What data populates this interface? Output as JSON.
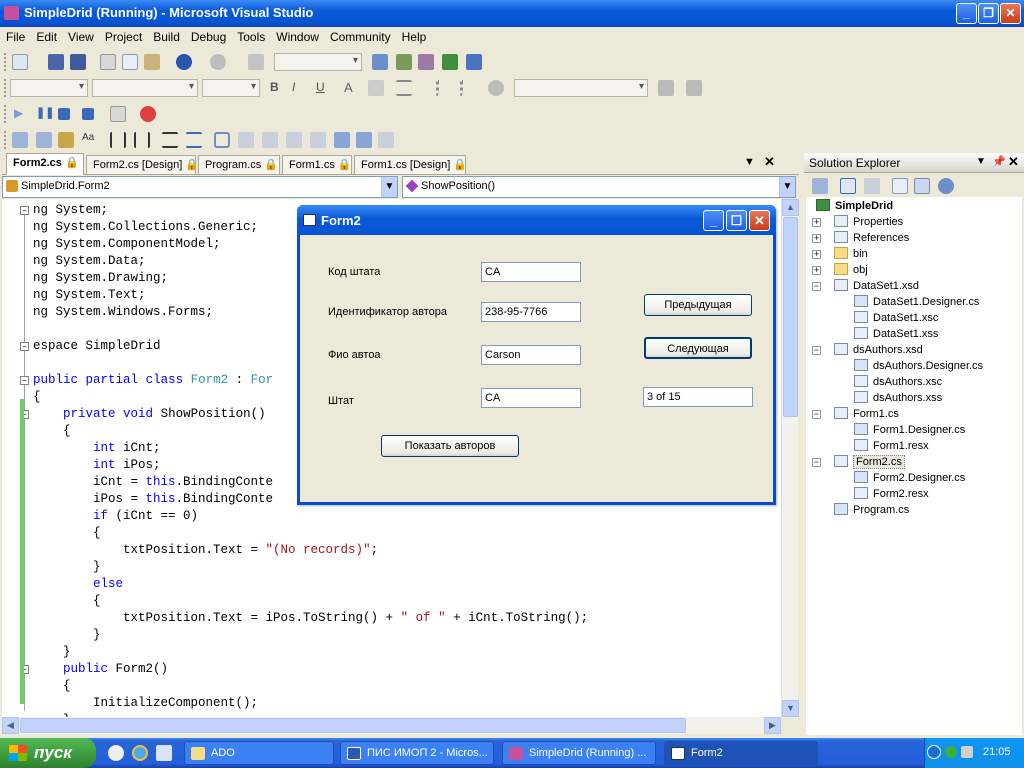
{
  "window": {
    "title": "SimpleDrid (Running) - Microsoft Visual Studio"
  },
  "menu": [
    "File",
    "Edit",
    "View",
    "Project",
    "Build",
    "Debug",
    "Tools",
    "Window",
    "Community",
    "Help"
  ],
  "tabs": [
    {
      "label": "Form2.cs",
      "active": true
    },
    {
      "label": "Form2.cs [Design]",
      "active": false
    },
    {
      "label": "Program.cs",
      "active": false
    },
    {
      "label": "Form1.cs",
      "active": false
    },
    {
      "label": "Form1.cs [Design]",
      "active": false
    }
  ],
  "nav": {
    "class_combo": "SimpleDrid.Form2",
    "member_combo": "ShowPosition()"
  },
  "code_lines": [
    [
      "",
      "ng System;"
    ],
    [
      "",
      "ng System.Collections.Generic;"
    ],
    [
      "",
      "ng System.ComponentModel;"
    ],
    [
      "",
      "ng System.Data;"
    ],
    [
      "",
      "ng System.Drawing;"
    ],
    [
      "",
      "ng System.Text;"
    ],
    [
      "",
      "ng System.Windows.Forms;"
    ],
    [
      "",
      ""
    ],
    [
      "",
      "espace SimpleDrid"
    ],
    [
      "",
      ""
    ],
    [
      "",
      "public partial class Form2 : For"
    ],
    [
      "",
      "{"
    ],
    [
      "",
      "    private void ShowPosition()"
    ],
    [
      "",
      "    {"
    ],
    [
      "",
      "        int iCnt;"
    ],
    [
      "",
      "        int iPos;"
    ],
    [
      "",
      "        iCnt = this.BindingConte"
    ],
    [
      "",
      "        iPos = this.BindingConte"
    ],
    [
      "",
      "        if (iCnt == 0)"
    ],
    [
      "",
      "        {"
    ],
    [
      "",
      "            txtPosition.Text = \"(No records)\";"
    ],
    [
      "",
      "        }"
    ],
    [
      "",
      "        else"
    ],
    [
      "",
      "        {"
    ],
    [
      "",
      "            txtPosition.Text = iPos.ToString() + \" of \" + iCnt.ToString();"
    ],
    [
      "",
      "        }"
    ],
    [
      "",
      "    }"
    ],
    [
      "",
      "    public Form2()"
    ],
    [
      "",
      "    {"
    ],
    [
      "",
      "        InitializeComponent();"
    ],
    [
      "",
      "    }"
    ]
  ],
  "solution_explorer": {
    "title": "Solution Explorer",
    "project": "SimpleDrid",
    "items": [
      {
        "label": "Properties",
        "level": 1,
        "expand": "+",
        "icon": "properties-icon"
      },
      {
        "label": "References",
        "level": 1,
        "expand": "+",
        "icon": "references-icon"
      },
      {
        "label": "bin",
        "level": 1,
        "expand": "+",
        "icon": "folder-icon"
      },
      {
        "label": "obj",
        "level": 1,
        "expand": "+",
        "icon": "folder-icon"
      },
      {
        "label": "DataSet1.xsd",
        "level": 1,
        "expand": "-",
        "icon": "xsd-file-icon"
      },
      {
        "label": "DataSet1.Designer.cs",
        "level": 2,
        "expand": "",
        "icon": "cs-file-icon"
      },
      {
        "label": "DataSet1.xsc",
        "level": 2,
        "expand": "",
        "icon": "file-icon"
      },
      {
        "label": "DataSet1.xss",
        "level": 2,
        "expand": "",
        "icon": "file-icon"
      },
      {
        "label": "dsAuthors.xsd",
        "level": 1,
        "expand": "-",
        "icon": "xsd-file-icon"
      },
      {
        "label": "dsAuthors.Designer.cs",
        "level": 2,
        "expand": "",
        "icon": "cs-file-icon"
      },
      {
        "label": "dsAuthors.xsc",
        "level": 2,
        "expand": "",
        "icon": "file-icon"
      },
      {
        "label": "dsAuthors.xss",
        "level": 2,
        "expand": "",
        "icon": "file-icon"
      },
      {
        "label": "Form1.cs",
        "level": 1,
        "expand": "-",
        "icon": "form-icon"
      },
      {
        "label": "Form1.Designer.cs",
        "level": 2,
        "expand": "",
        "icon": "cs-file-icon"
      },
      {
        "label": "Form1.resx",
        "level": 2,
        "expand": "",
        "icon": "file-icon"
      },
      {
        "label": "Form2.cs",
        "level": 1,
        "expand": "-",
        "icon": "form-icon",
        "selected": true
      },
      {
        "label": "Form2.Designer.cs",
        "level": 2,
        "expand": "",
        "icon": "cs-file-icon"
      },
      {
        "label": "Form2.resx",
        "level": 2,
        "expand": "",
        "icon": "file-icon"
      },
      {
        "label": "Program.cs",
        "level": 1,
        "expand": "",
        "icon": "cs-file-icon"
      }
    ]
  },
  "form2": {
    "title": "Form2",
    "label_state_code": "Код штата",
    "value_state_code": "CA",
    "label_author_id": "Идентификатор автора",
    "value_author_id": "238-95-7766",
    "label_name": "Фио автоа",
    "value_name": "Carson",
    "label_state": "Штат",
    "value_state": "CA",
    "position": "3 of 15",
    "btn_prev": "Предыдущая",
    "btn_next": "Следующая",
    "btn_show": "Показать авторов"
  },
  "taskbar": {
    "start": "пуск",
    "tasks": [
      {
        "label": "ADO",
        "active": false
      },
      {
        "label": "ПИС ИМОП 2 - Micros...",
        "active": false
      },
      {
        "label": "SimpleDrid (Running) ...",
        "active": false
      },
      {
        "label": "Form2",
        "active": true
      }
    ],
    "clock": "21:05"
  },
  "colors": {
    "keyword": "#0000ff",
    "type": "#2b91af",
    "string": "#a31515",
    "xp_blue": "#0a5ad8",
    "start_green": "#3d9a3d"
  }
}
